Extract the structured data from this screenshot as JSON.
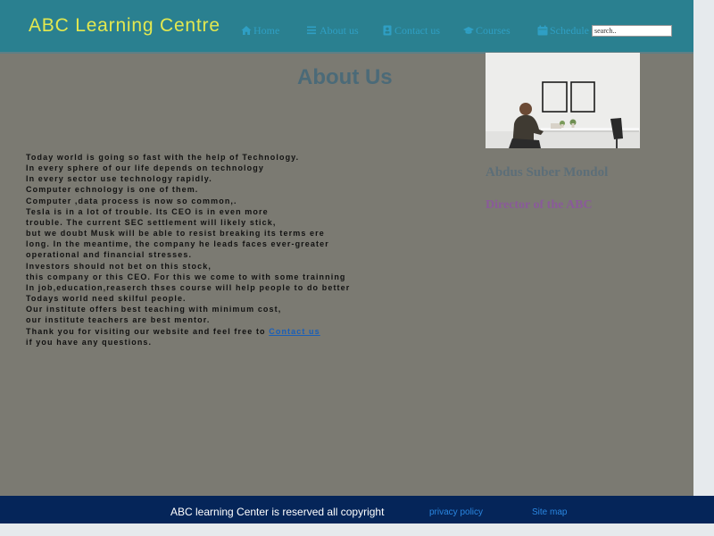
{
  "header": {
    "brand": "ABC Learning Centre",
    "search_placeholder": "search.."
  },
  "nav": {
    "items": [
      {
        "label": "Home",
        "icon": "home-icon"
      },
      {
        "label": "About us",
        "icon": "list-icon"
      },
      {
        "label": "Contact us",
        "icon": "contact-card-icon"
      },
      {
        "label": "Courses",
        "icon": "graduation-cap-icon"
      },
      {
        "label": "Schedule",
        "icon": "calendar-icon"
      }
    ]
  },
  "main": {
    "title": "About Us",
    "lines": [
      "Today world is going so fast with the help of Technology.",
      "In every sphere of our life depends on technology",
      "In every sector use technology rapidly.",
      "Computer echnology is one of them.",
      "Computer ,data process is now so common,.",
      "Tesla is in a lot of trouble. Its CEO is in even more",
      "trouble. The current SEC settlement will likely stick,",
      "but we doubt Musk will be able to resist breaking its terms ere",
      "long. In the meantime, the company he leads faces ever-greater",
      "operational and financial stresses.",
      "Investors should not bet on this stock,",
      "this company or this CEO. For this we come to with some trainning",
      "In job,education,reaserch thses course will help people to do better",
      "Todays world need skilful people.",
      "Our institute offers best teaching with minimum cost,",
      "our institute teachers are best mentor."
    ],
    "thanks_prefix": "Thank you for visiting our website and feel free to",
    "contact_link": "Contact us",
    "last_line": "if you have any questions."
  },
  "profile": {
    "name": "Abdus Suber Mondol",
    "role": "Director of the ABC"
  },
  "footer": {
    "copyright": "ABC learning Center is reserved all copyright",
    "links": [
      "privacy policy",
      "Site map"
    ]
  },
  "colors": {
    "header_bg": "#2a8090",
    "page_bg": "#7b7a72",
    "brand": "#e3e84f",
    "footer_bg": "#052559",
    "link": "#2f9fc4"
  }
}
